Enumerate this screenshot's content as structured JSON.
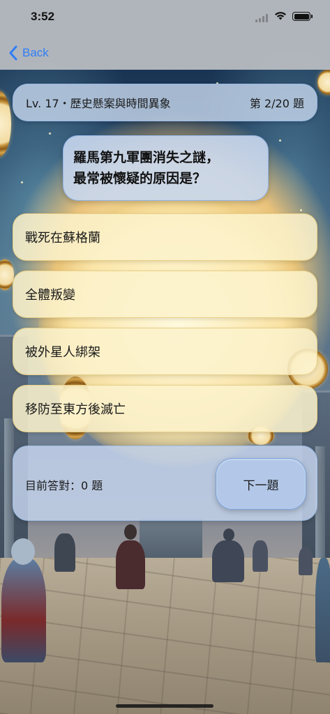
{
  "status_bar": {
    "time": "3:52"
  },
  "nav": {
    "back_label": "Back"
  },
  "quiz": {
    "level_title": "Lv. 17・歷史懸案與時間異象",
    "progress_label": "第 2/20 題",
    "question_lines": [
      "羅馬第九軍團消失之謎，",
      "最常被懷疑的原因是？"
    ],
    "options": [
      {
        "label": "戰死在蘇格蘭"
      },
      {
        "label": "全體叛變"
      },
      {
        "label": "被外星人綁架"
      },
      {
        "label": "移防至東方後滅亡"
      }
    ],
    "score_label": "目前答對：0 題",
    "next_label": "下一題"
  },
  "colors": {
    "accent": "#2f7ef5",
    "option_fill": "#fcf2cc",
    "panel_fill": "#c5d5ec"
  },
  "icons": [
    "chevron-left-icon",
    "cellular-signal-icon",
    "wifi-icon",
    "battery-icon"
  ]
}
